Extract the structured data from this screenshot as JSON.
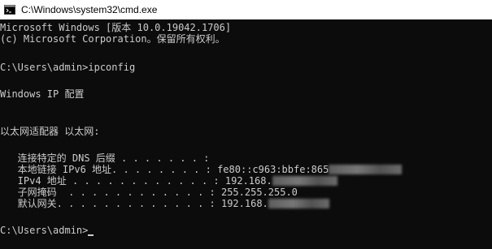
{
  "window": {
    "title": "C:\\Windows\\system32\\cmd.exe",
    "icon": "cmd-icon"
  },
  "console": {
    "header_line1": "Microsoft Windows [版本 10.0.19042.1706]",
    "header_line2": "(c) Microsoft Corporation。保留所有权利。",
    "prompt1": "C:\\Users\\admin>",
    "command": "ipconfig",
    "ip_config_title": "Windows IP 配置",
    "adapter_title": "以太网适配器 以太网:",
    "rows": [
      {
        "label": "   连接特定的 DNS 后缀 . . . . . . . : ",
        "value": ""
      },
      {
        "label": "   本地链接 IPv6 地址. . . . . . . . : ",
        "value": "fe80::c963:bbfe:865"
      },
      {
        "label": "   IPv4 地址 . . . . . . . . . . . . : ",
        "value": "192.168."
      },
      {
        "label": "   子网掩码  . . . . . . . . . . . . : ",
        "value": "255.255.255.0"
      },
      {
        "label": "   默认网关. . . . . . . . . . . . . : ",
        "value": "192.168."
      }
    ],
    "prompt2": "C:\\Users\\admin>"
  }
}
